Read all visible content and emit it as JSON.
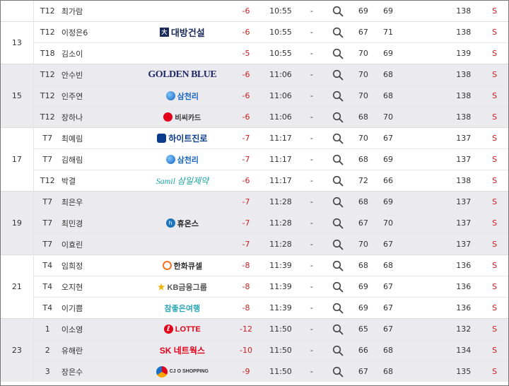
{
  "colors": {
    "score_red": "#c81e1e",
    "s_red": "#d11a1a",
    "shaded_band": "#ebebef"
  },
  "groups": [
    {
      "rank": "",
      "shaded": false,
      "players": [
        {
          "pos": "T12",
          "name": "최가람",
          "sponsor": {
            "name": "",
            "style": "none"
          },
          "score": "-6",
          "time": "10:55",
          "dash": "-",
          "r1": "69",
          "r2": "69",
          "total": "138",
          "s": "S"
        }
      ]
    },
    {
      "rank": "13",
      "shaded": false,
      "players": [
        {
          "pos": "T12",
          "name": "이정은6",
          "sponsor": {
            "name": "대방건설",
            "style": "daebang"
          },
          "score": "-6",
          "time": "10:55",
          "dash": "-",
          "r1": "67",
          "r2": "71",
          "total": "138",
          "s": "S"
        },
        {
          "pos": "T18",
          "name": "김소이",
          "sponsor": {
            "name": "",
            "style": "none"
          },
          "score": "-5",
          "time": "10:55",
          "dash": "-",
          "r1": "70",
          "r2": "69",
          "total": "139",
          "s": "S"
        }
      ]
    },
    {
      "rank": "15",
      "shaded": true,
      "players": [
        {
          "pos": "T12",
          "name": "안수빈",
          "sponsor": {
            "name": "GOLDEN BLUE",
            "style": "golden"
          },
          "score": "-6",
          "time": "11:06",
          "dash": "-",
          "r1": "70",
          "r2": "68",
          "total": "138",
          "s": "S"
        },
        {
          "pos": "T12",
          "name": "인주연",
          "sponsor": {
            "name": "삼천리",
            "style": "samchully"
          },
          "score": "-6",
          "time": "11:06",
          "dash": "-",
          "r1": "70",
          "r2": "68",
          "total": "138",
          "s": "S"
        },
        {
          "pos": "T12",
          "name": "장하나",
          "sponsor": {
            "name": "비씨카드",
            "style": "bccard"
          },
          "score": "-6",
          "time": "11:06",
          "dash": "-",
          "r1": "68",
          "r2": "70",
          "total": "138",
          "s": "S"
        }
      ]
    },
    {
      "rank": "17",
      "shaded": false,
      "players": [
        {
          "pos": "T7",
          "name": "최예림",
          "sponsor": {
            "name": "하이트진로",
            "style": "hite"
          },
          "score": "-7",
          "time": "11:17",
          "dash": "-",
          "r1": "70",
          "r2": "67",
          "total": "137",
          "s": "S"
        },
        {
          "pos": "T7",
          "name": "김해림",
          "sponsor": {
            "name": "삼천리",
            "style": "samchully"
          },
          "score": "-7",
          "time": "11:17",
          "dash": "-",
          "r1": "68",
          "r2": "69",
          "total": "137",
          "s": "S"
        },
        {
          "pos": "T12",
          "name": "박결",
          "sponsor": {
            "name": "Samil 삼일제약",
            "style": "samil"
          },
          "score": "-6",
          "time": "11:17",
          "dash": "-",
          "r1": "72",
          "r2": "66",
          "total": "138",
          "s": "S"
        }
      ]
    },
    {
      "rank": "19",
      "shaded": true,
      "players": [
        {
          "pos": "T7",
          "name": "최은우",
          "sponsor": {
            "name": "",
            "style": "none"
          },
          "score": "-7",
          "time": "11:28",
          "dash": "-",
          "r1": "68",
          "r2": "69",
          "total": "137",
          "s": "S"
        },
        {
          "pos": "T7",
          "name": "최민경",
          "sponsor": {
            "name": "휴온스",
            "style": "huons"
          },
          "score": "-7",
          "time": "11:28",
          "dash": "-",
          "r1": "67",
          "r2": "70",
          "total": "137",
          "s": "S"
        },
        {
          "pos": "T7",
          "name": "이효린",
          "sponsor": {
            "name": "",
            "style": "none"
          },
          "score": "-7",
          "time": "11:28",
          "dash": "-",
          "r1": "70",
          "r2": "67",
          "total": "137",
          "s": "S"
        }
      ]
    },
    {
      "rank": "21",
      "shaded": false,
      "players": [
        {
          "pos": "T4",
          "name": "임희정",
          "sponsor": {
            "name": "한화큐셀",
            "style": "hanwha"
          },
          "score": "-8",
          "time": "11:39",
          "dash": "-",
          "r1": "68",
          "r2": "68",
          "total": "136",
          "s": "S"
        },
        {
          "pos": "T4",
          "name": "오지현",
          "sponsor": {
            "name": "KB금융그룹",
            "style": "kb"
          },
          "score": "-8",
          "time": "11:39",
          "dash": "-",
          "r1": "69",
          "r2": "67",
          "total": "136",
          "s": "S"
        },
        {
          "pos": "T4",
          "name": "이기쁨",
          "sponsor": {
            "name": "참좋은여행",
            "style": "chamjoeun"
          },
          "score": "-8",
          "time": "11:39",
          "dash": "-",
          "r1": "69",
          "r2": "67",
          "total": "136",
          "s": "S"
        }
      ]
    },
    {
      "rank": "23",
      "shaded": true,
      "players": [
        {
          "pos": "1",
          "name": "이소영",
          "sponsor": {
            "name": "LOTTE",
            "style": "lotte"
          },
          "score": "-12",
          "time": "11:50",
          "dash": "-",
          "r1": "65",
          "r2": "67",
          "total": "132",
          "s": "S"
        },
        {
          "pos": "2",
          "name": "유해란",
          "sponsor": {
            "name": "SK 네트웍스",
            "style": "sk"
          },
          "score": "-10",
          "time": "11:50",
          "dash": "-",
          "r1": "66",
          "r2": "68",
          "total": "134",
          "s": "S"
        },
        {
          "pos": "3",
          "name": "장은수",
          "sponsor": {
            "name": "CJ O SHOPPING",
            "style": "cj"
          },
          "score": "-9",
          "time": "11:50",
          "dash": "-",
          "r1": "67",
          "r2": "68",
          "total": "135",
          "s": "S"
        }
      ]
    }
  ]
}
